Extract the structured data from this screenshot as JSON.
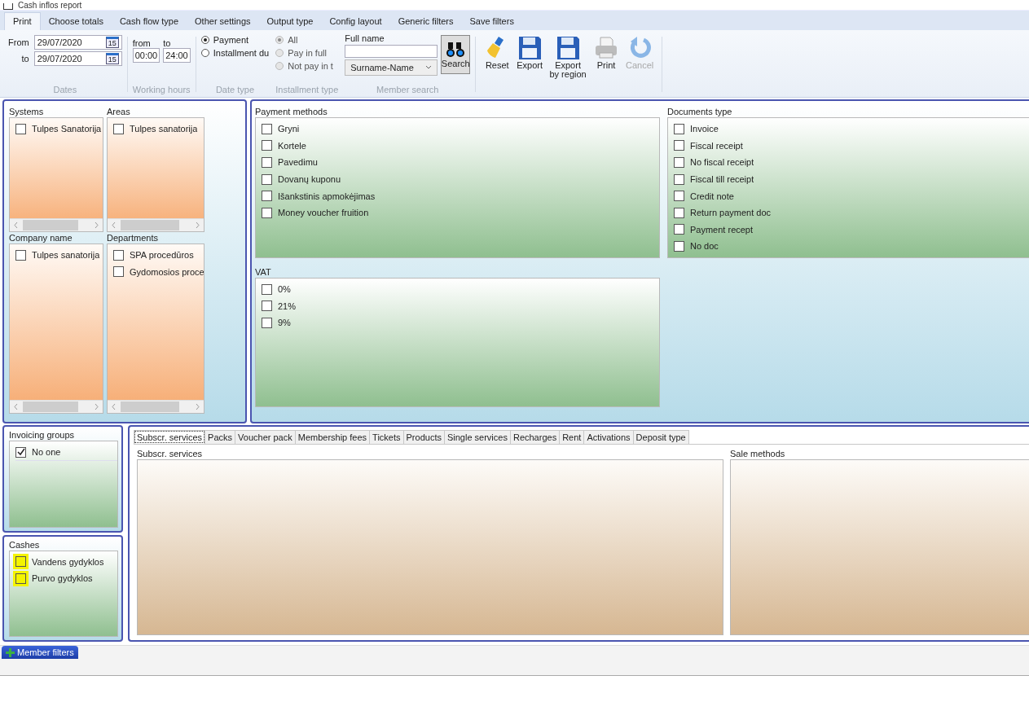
{
  "window": {
    "title": "Cash inflos report"
  },
  "tabs": [
    {
      "label": "Print",
      "selected": true
    },
    {
      "label": "Choose totals",
      "selected": false
    },
    {
      "label": "Cash flow type",
      "selected": false
    },
    {
      "label": "Other settings",
      "selected": false
    },
    {
      "label": "Output type",
      "selected": false
    },
    {
      "label": "Config layout",
      "selected": false
    },
    {
      "label": "Generic filters",
      "selected": false
    },
    {
      "label": "Save filters",
      "selected": false
    }
  ],
  "dates": {
    "label": "Dates",
    "from_label": "From",
    "from_value": "29/07/2020",
    "to_label": "to",
    "to_value": "29/07/2020",
    "from_calendar_day": "15",
    "to_calendar_day": "15"
  },
  "working_hours": {
    "label": "Working hours",
    "from_label": "from",
    "to_label": "to",
    "from_value": "00:00",
    "to_value": "24:00"
  },
  "date_type": {
    "label": "Date type",
    "options": [
      {
        "label": "Payment",
        "selected": true,
        "disabled": false
      },
      {
        "label": "Installment du",
        "selected": false,
        "disabled": false
      }
    ]
  },
  "installment_type": {
    "label": "Installment type",
    "options": [
      {
        "label": "All",
        "selected": true,
        "disabled": true
      },
      {
        "label": "Pay in full",
        "selected": false,
        "disabled": true
      },
      {
        "label": "Not pay in t",
        "selected": false,
        "disabled": true
      }
    ]
  },
  "member_search": {
    "label": "Member search",
    "full_name_label": "Full name",
    "order": "Surname-Name",
    "search_button": "Search"
  },
  "actions": [
    {
      "kind": "reset",
      "label": "Reset",
      "disabled": false
    },
    {
      "kind": "export",
      "label": "Export",
      "disabled": false
    },
    {
      "kind": "export",
      "label": "Export by region",
      "disabled": false
    },
    {
      "kind": "print",
      "label": "Print",
      "disabled": false
    },
    {
      "kind": "cancel",
      "label": "Cancel",
      "disabled": true
    }
  ],
  "systems": {
    "title": "Systems",
    "items": [
      {
        "label": "Tulpes Sanatorija",
        "checked": false
      }
    ]
  },
  "areas": {
    "title": "Areas",
    "items": [
      {
        "label": "Tulpes sanatorija",
        "checked": false
      }
    ]
  },
  "company_name": {
    "title": "Company name",
    "items": [
      {
        "label": "Tulpes sanatorija",
        "checked": false
      }
    ]
  },
  "departments": {
    "title": "Departments",
    "items": [
      {
        "label": "SPA procedūros",
        "checked": false
      },
      {
        "label": "Gydomosios proce",
        "checked": false
      }
    ]
  },
  "payment_methods": {
    "title": "Payment methods",
    "items": [
      {
        "label": "Gryni",
        "checked": false
      },
      {
        "label": "Kortele",
        "checked": false
      },
      {
        "label": "Pavedimu",
        "checked": false
      },
      {
        "label": "Dovanų kuponu",
        "checked": false
      },
      {
        "label": "Išankstinis apmokėjimas",
        "checked": false
      },
      {
        "label": "Money voucher fruition",
        "checked": false
      }
    ]
  },
  "documents_type": {
    "title": "Documents type",
    "items": [
      {
        "label": "Invoice",
        "checked": false
      },
      {
        "label": "Fiscal receipt",
        "checked": false
      },
      {
        "label": "No fiscal receipt",
        "checked": false
      },
      {
        "label": "Fiscal till receipt",
        "checked": false
      },
      {
        "label": "Credit note",
        "checked": false
      },
      {
        "label": "Return payment doc",
        "checked": false
      },
      {
        "label": "Payment recept",
        "checked": false
      },
      {
        "label": "No doc",
        "checked": false
      }
    ]
  },
  "vat": {
    "title": "VAT",
    "items": [
      {
        "label": "0%",
        "checked": false
      },
      {
        "label": "21%",
        "checked": false
      },
      {
        "label": "9%",
        "checked": false
      }
    ]
  },
  "invoicing_groups": {
    "title": "Invoicing groups",
    "items": [
      {
        "label": "No one",
        "checked": true
      }
    ]
  },
  "cashes": {
    "title": "Cashes",
    "items": [
      {
        "label": "Vandens gydyklos",
        "checked": false,
        "highlighted": true
      },
      {
        "label": "Purvo gydyklos",
        "checked": false,
        "highlighted": true
      }
    ]
  },
  "service_tabs": [
    {
      "label": "Subscr. services",
      "selected": true
    },
    {
      "label": "Packs",
      "selected": false
    },
    {
      "label": "Voucher pack",
      "selected": false
    },
    {
      "label": "Membership fees",
      "selected": false
    },
    {
      "label": "Tickets",
      "selected": false
    },
    {
      "label": "Products",
      "selected": false
    },
    {
      "label": "Single services",
      "selected": false
    },
    {
      "label": "Recharges",
      "selected": false
    },
    {
      "label": "Rent",
      "selected": false
    },
    {
      "label": "Activations",
      "selected": false
    },
    {
      "label": "Deposit type",
      "selected": false
    }
  ],
  "service_panels": {
    "left_title": "Subscr. services",
    "right_title": "Sale methods"
  },
  "member_filters_tab": {
    "label": "Member filters"
  }
}
